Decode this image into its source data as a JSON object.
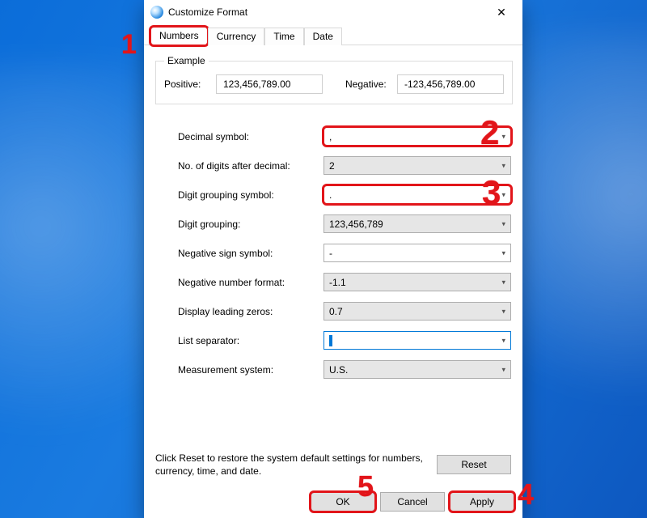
{
  "window": {
    "title": "Customize Format"
  },
  "tabs": [
    "Numbers",
    "Currency",
    "Time",
    "Date"
  ],
  "example": {
    "legend": "Example",
    "positive_label": "Positive:",
    "positive_value": "123,456,789.00",
    "negative_label": "Negative:",
    "negative_value": "-123,456,789.00"
  },
  "fields": {
    "decimal_symbol": {
      "label": "Decimal symbol:",
      "value": ","
    },
    "digits_after_decimal": {
      "label": "No. of digits after decimal:",
      "value": "2"
    },
    "digit_grouping_symbol": {
      "label": "Digit grouping symbol:",
      "value": "."
    },
    "digit_grouping": {
      "label": "Digit grouping:",
      "value": "123,456,789"
    },
    "negative_sign": {
      "label": "Negative sign symbol:",
      "value": "-"
    },
    "negative_format": {
      "label": "Negative number format:",
      "value": "-1.1"
    },
    "leading_zeros": {
      "label": "Display leading zeros:",
      "value": "0.7"
    },
    "list_separator": {
      "label": "List separator:",
      "value": ""
    },
    "measurement": {
      "label": "Measurement system:",
      "value": "U.S."
    }
  },
  "reset": {
    "text": "Click Reset to restore the system default settings for numbers, currency, time, and date.",
    "button": "Reset"
  },
  "actions": {
    "ok": "OK",
    "cancel": "Cancel",
    "apply": "Apply"
  },
  "annotations": [
    "1",
    "2",
    "3",
    "4",
    "5"
  ]
}
